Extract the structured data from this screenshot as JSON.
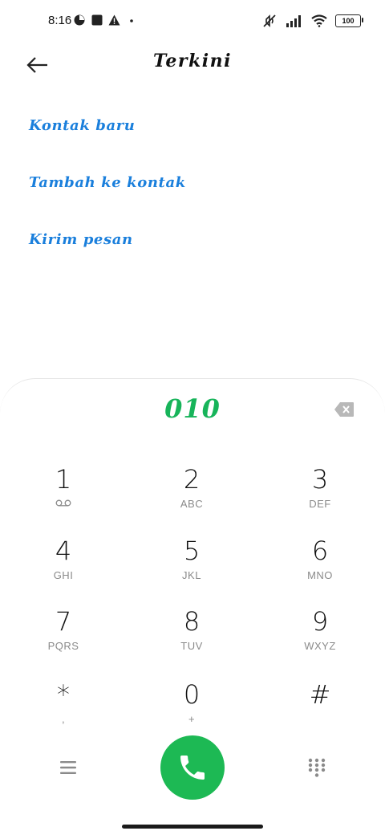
{
  "status": {
    "time": "8:16",
    "battery": "100",
    "icons_left": [
      "data-saver-icon",
      "square-notification-icon",
      "warning-icon",
      "dot-icon"
    ],
    "icons_right": [
      "mute-icon",
      "signal-icon",
      "wifi-icon",
      "battery-icon"
    ]
  },
  "header": {
    "title": "Terkini"
  },
  "actions": [
    {
      "label": "Kontak baru"
    },
    {
      "label": "Tambah ke kontak"
    },
    {
      "label": "Kirim pesan"
    }
  ],
  "dialpad": {
    "number": "010",
    "keys": [
      {
        "digit": "1",
        "letters": ""
      },
      {
        "digit": "2",
        "letters": "ABC"
      },
      {
        "digit": "3",
        "letters": "DEF"
      },
      {
        "digit": "4",
        "letters": "GHI"
      },
      {
        "digit": "5",
        "letters": "JKL"
      },
      {
        "digit": "6",
        "letters": "MNO"
      },
      {
        "digit": "7",
        "letters": "PQRS"
      },
      {
        "digit": "8",
        "letters": "TUV"
      },
      {
        "digit": "9",
        "letters": "WXYZ"
      },
      {
        "digit": "*",
        "letters": ","
      },
      {
        "digit": "0",
        "letters": "+"
      },
      {
        "digit": "#",
        "letters": ""
      }
    ]
  },
  "colors": {
    "accent_blue": "#1a7fdc",
    "call_green": "#1db954",
    "number_green": "#17b45a"
  }
}
